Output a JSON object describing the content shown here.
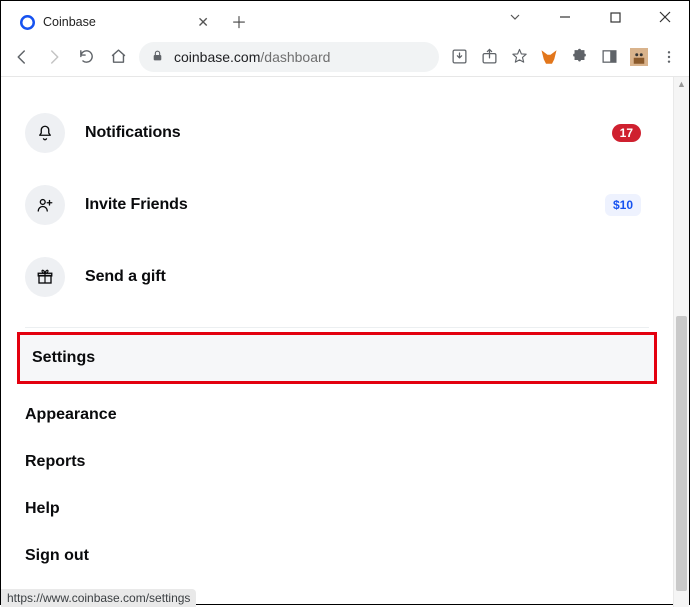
{
  "window": {
    "title": "Coinbase"
  },
  "address": {
    "domain": "coinbase.com",
    "path": "/dashboard"
  },
  "menu": {
    "notifications": {
      "label": "Notifications",
      "count": "17"
    },
    "invite": {
      "label": "Invite Friends",
      "reward": "$10"
    },
    "gift": {
      "label": "Send a gift"
    }
  },
  "settings_list": {
    "settings": "Settings",
    "appearance": "Appearance",
    "reports": "Reports",
    "help": "Help",
    "signout": "Sign out"
  },
  "status_url": "https://www.coinbase.com/settings"
}
